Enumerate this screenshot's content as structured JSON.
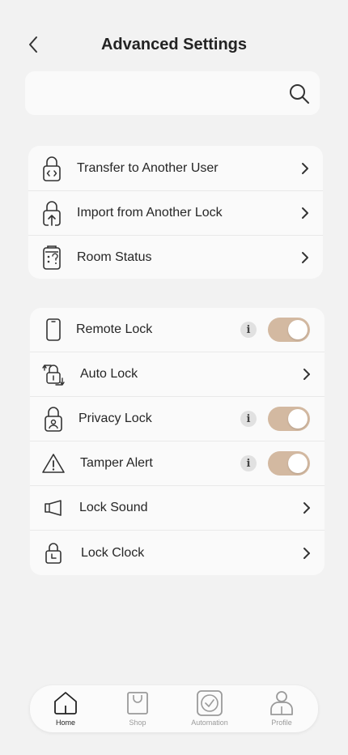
{
  "header": {
    "title": "Advanced Settings",
    "back_icon": "chevron-left-icon"
  },
  "search": {
    "value": "",
    "placeholder": "",
    "icon": "search-icon"
  },
  "group1": {
    "items": [
      {
        "label": "Transfer to Another User",
        "icon": "lock-code-icon"
      },
      {
        "label": "Import from Another Lock",
        "icon": "lock-upload-icon"
      },
      {
        "label": "Room Status",
        "icon": "clipboard-status-icon"
      }
    ]
  },
  "group2": {
    "items": [
      {
        "label": "Remote Lock",
        "icon": "phone-icon",
        "control": "toggle",
        "on": true,
        "info": "i"
      },
      {
        "label": "Auto Lock",
        "icon": "auto-lock-icon",
        "control": "chevron"
      },
      {
        "label": "Privacy Lock",
        "icon": "lock-person-icon",
        "control": "toggle",
        "on": true,
        "info": "i"
      },
      {
        "label": "Tamper Alert",
        "icon": "warning-icon",
        "control": "toggle",
        "on": true,
        "info": "i"
      },
      {
        "label": "Lock Sound",
        "icon": "speaker-icon",
        "control": "chevron"
      },
      {
        "label": "Lock Clock",
        "icon": "lock-clock-icon",
        "control": "chevron"
      }
    ]
  },
  "tabbar": {
    "tabs": [
      {
        "label": "Home",
        "icon": "home-icon",
        "active": true
      },
      {
        "label": "Shop",
        "icon": "shopping-bag-icon",
        "active": false
      },
      {
        "label": "Automation",
        "icon": "automation-icon",
        "active": false
      },
      {
        "label": "Profile",
        "icon": "profile-icon",
        "active": false
      }
    ]
  },
  "colors": {
    "toggle_on": "#d3b9a1",
    "background": "#f2f2f2",
    "card": "#fafafa"
  }
}
